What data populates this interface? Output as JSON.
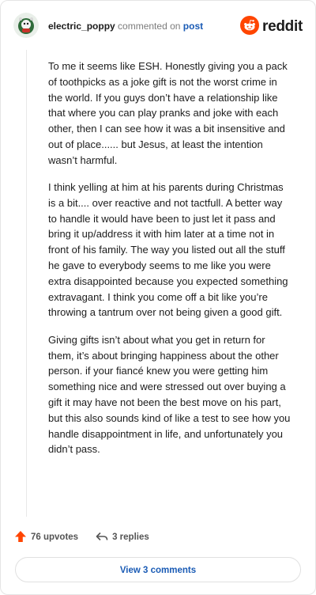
{
  "comment": {
    "username": "electric_poppy",
    "action_text": "commented on",
    "link_text": "post",
    "paragraphs": [
      "To me it seems like ESH. Honestly giving you a pack of toothpicks as a joke gift is not the worst crime in the world. If you guys don’t have a relationship like that where you can play pranks and joke with each other, then I can see how it was a bit insensitive and out of place...... but Jesus, at least the intention wasn’t harmful.",
      "I think yelling at him at his parents during Christmas is a bit.... over reactive and not tactfull. A better way to handle it would have been to just let it pass and bring it up/address it with him later at a time not in front of his family. The way you listed out all the stuff he gave to everybody seems to me like you were extra disappointed because you expected something extravagant. I think you come off a bit like you’re throwing a tantrum over not being given a good gift.",
      "Giving gifts isn’t about what you get in return for them, it’s about bringing happiness about the other person. if your fiancé knew you were getting him something nice and were stressed out over buying a gift it may have not been the best move on his part, but this also sounds kind of like a test to see how you handle disappointment in life, and unfortunately you didn’t pass."
    ],
    "upvotes_label": "76 upvotes",
    "replies_label": "3 replies"
  },
  "brand": {
    "name": "reddit",
    "accent_color": "#ff4500"
  },
  "footer": {
    "view_comments_label": "View 3 comments"
  },
  "colors": {
    "upvote": "#ff4500",
    "link": "#1a5bb5"
  },
  "icons": [
    "user-avatar-icon",
    "reddit-logo-icon",
    "upvote-arrow-icon",
    "reply-arrow-icon"
  ]
}
